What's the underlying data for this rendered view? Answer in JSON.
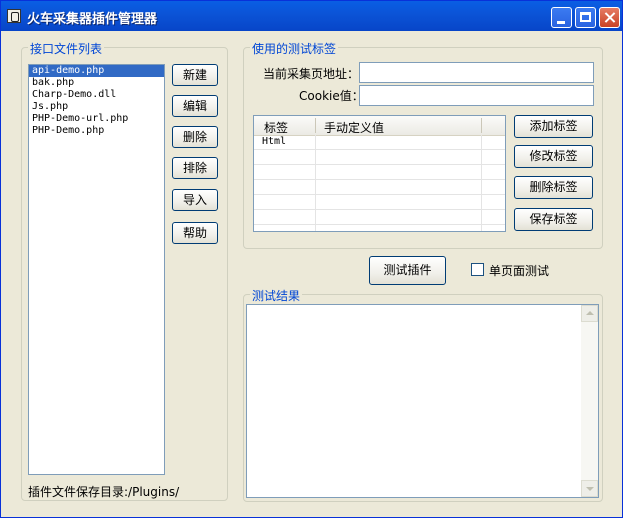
{
  "window": {
    "title": "火车采集器插件管理器"
  },
  "left_group": {
    "label": "接口文件列表",
    "files": [
      "api-demo.php",
      "bak.php",
      "Charp-Demo.dll",
      "Js.php",
      "PHP-Demo-url.php",
      "PHP-Demo.php"
    ],
    "selected_index": 0,
    "buttons": {
      "new": "新建",
      "edit": "编辑",
      "delete": "删除",
      "exclude": "排除",
      "import": "导入",
      "help": "帮助"
    },
    "save_dir": "插件文件保存目录:/Plugins/"
  },
  "tags_group": {
    "label": "使用的测试标签",
    "url_label": "当前采集页地址：",
    "url_value": "",
    "cookie_label": "Cookie值：",
    "cookie_value": "",
    "columns": [
      "标签",
      "手动定义值"
    ],
    "rows": [
      [
        "Html",
        ""
      ]
    ],
    "buttons": {
      "add": "添加标签",
      "modify": "修改标签",
      "delete": "删除标签",
      "save": "保存标签"
    }
  },
  "test": {
    "button": "测试插件",
    "single_page_label": "单页面测试",
    "single_page_checked": false
  },
  "result_group": {
    "label": "测试结果",
    "text": ""
  }
}
